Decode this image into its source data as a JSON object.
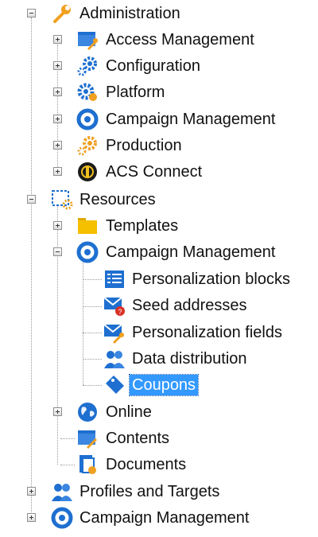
{
  "tree": {
    "administration": {
      "label": "Administration",
      "icon": "wrench-icon",
      "children": {
        "access_management": {
          "label": "Access Management",
          "icon": "folder-key-icon"
        },
        "configuration": {
          "label": "Configuration",
          "icon": "gears-icon"
        },
        "platform": {
          "label": "Platform",
          "icon": "platform-gear-icon"
        },
        "campaign_management": {
          "label": "Campaign Management",
          "icon": "campaign-icon"
        },
        "production": {
          "label": "Production",
          "icon": "orange-gears-icon"
        },
        "acs_connect": {
          "label": "ACS Connect",
          "icon": "acs-connect-icon"
        }
      }
    },
    "resources": {
      "label": "Resources",
      "icon": "resources-icon",
      "children": {
        "templates": {
          "label": "Templates",
          "icon": "folder-icon"
        },
        "campaign_management": {
          "label": "Campaign Management",
          "icon": "campaign-icon",
          "children": {
            "personalization_blocks": {
              "label": "Personalization blocks",
              "icon": "list-icon"
            },
            "seed_addresses": {
              "label": "Seed addresses",
              "icon": "envelope-question-icon"
            },
            "personalization_fields": {
              "label": "Personalization fields",
              "icon": "envelope-key-icon"
            },
            "data_distribution": {
              "label": "Data distribution",
              "icon": "people-icon"
            },
            "coupons": {
              "label": "Coupons",
              "icon": "coupon-tag-icon",
              "selected": true
            }
          }
        },
        "online": {
          "label": "Online",
          "icon": "globe-icon"
        },
        "contents": {
          "label": "Contents",
          "icon": "folder-pencil-icon"
        },
        "documents": {
          "label": "Documents",
          "icon": "document-icon"
        }
      }
    },
    "profiles_and_targets": {
      "label": "Profiles and Targets",
      "icon": "people-icon"
    },
    "campaign_management": {
      "label": "Campaign Management",
      "icon": "campaign-icon"
    }
  },
  "colors": {
    "selection": "#3399ff",
    "accent_blue": "#1e6fd0",
    "accent_orange": "#f0a020"
  }
}
